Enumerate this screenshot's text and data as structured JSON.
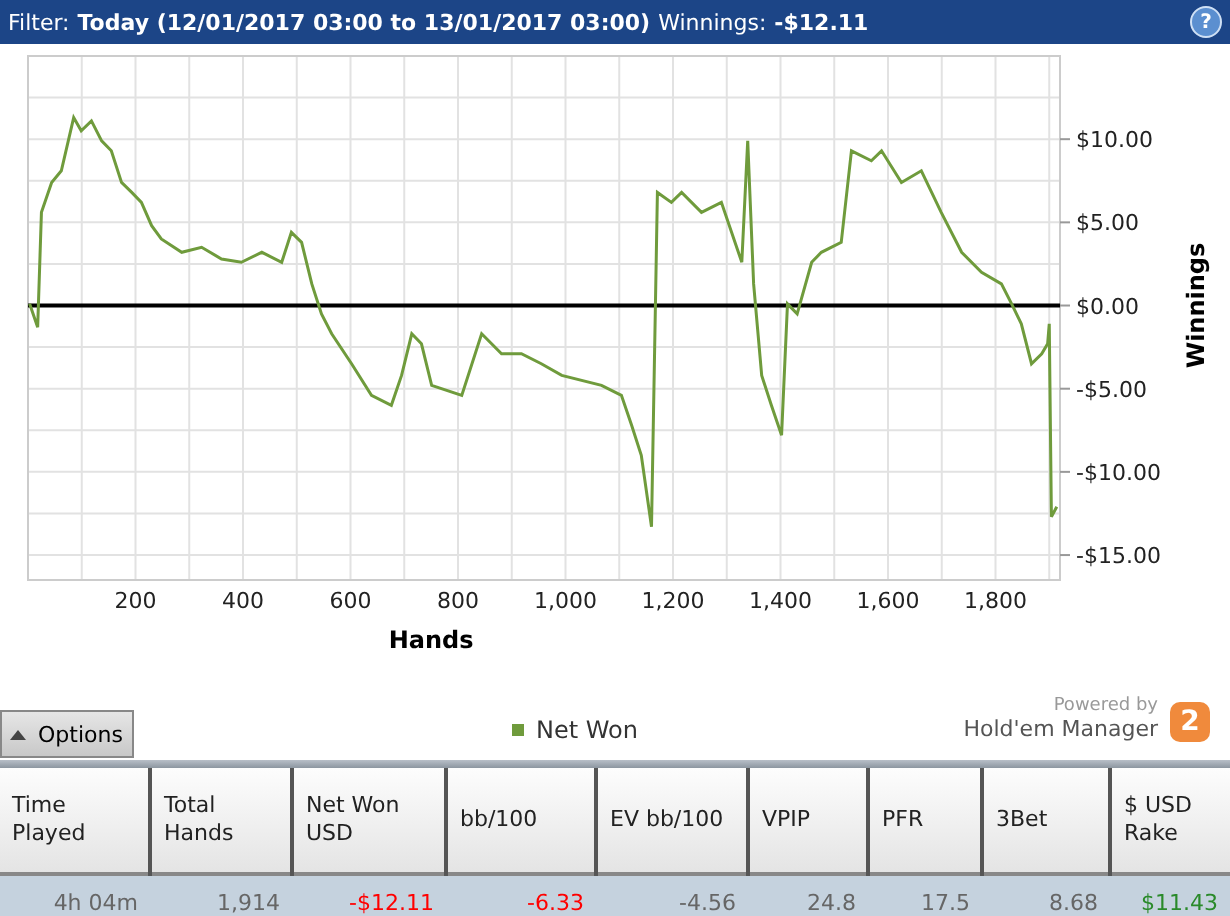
{
  "filter_bar": {
    "filter_label": "Filter:",
    "filter_value": "Today (12/01/2017 03:00 to 13/01/2017 03:00)",
    "winnings_label": "Winnings:",
    "winnings_value": "-$12.11",
    "help": "?"
  },
  "chart": {
    "chart_data": {
      "type": "line",
      "grid": true,
      "xlabel": "Hands",
      "ylabel": "Winnings",
      "xlim": [
        0,
        1920
      ],
      "ylim": [
        -16.5,
        15
      ],
      "xticks": [
        {
          "value": 200,
          "label": "200"
        },
        {
          "value": 400,
          "label": "400"
        },
        {
          "value": 600,
          "label": "600"
        },
        {
          "value": 800,
          "label": "800"
        },
        {
          "value": 1000,
          "label": "1,000"
        },
        {
          "value": 1200,
          "label": "1,200"
        },
        {
          "value": 1400,
          "label": "1,400"
        },
        {
          "value": 1600,
          "label": "1,600"
        },
        {
          "value": 1800,
          "label": "1,800"
        }
      ],
      "yticks": [
        {
          "value": 10,
          "label": "$10.00"
        },
        {
          "value": 5,
          "label": "$5.00"
        },
        {
          "value": 0,
          "label": "$0.00"
        },
        {
          "value": -5,
          "label": "-$5.00"
        },
        {
          "value": -10,
          "label": "-$10.00"
        },
        {
          "value": -15,
          "label": "-$15.00"
        }
      ],
      "x": [
        3,
        18,
        25,
        44,
        62,
        85,
        99,
        118,
        137,
        155,
        174,
        193,
        211,
        230,
        248,
        286,
        323,
        360,
        397,
        435,
        472,
        490,
        509,
        528,
        546,
        565,
        602,
        639,
        676,
        695,
        714,
        732,
        751,
        807,
        844,
        881,
        918,
        955,
        993,
        1067,
        1104,
        1123,
        1141,
        1160,
        1171,
        1197,
        1216,
        1253,
        1290,
        1328,
        1339,
        1350,
        1365,
        1383,
        1402,
        1413,
        1431,
        1458,
        1476,
        1513,
        1532,
        1569,
        1588,
        1625,
        1662,
        1699,
        1737,
        1774,
        1811,
        1830,
        1848,
        1867,
        1886,
        1897,
        1900,
        1904,
        1914
      ],
      "series": [
        {
          "name": "Net Won",
          "color": "#6f9b3c",
          "values": [
            0.1,
            -1.3,
            5.6,
            7.4,
            8.1,
            11.3,
            10.5,
            11.1,
            9.9,
            9.3,
            7.4,
            6.8,
            6.2,
            4.8,
            4.0,
            3.2,
            3.5,
            2.8,
            2.6,
            3.2,
            2.6,
            4.4,
            3.8,
            1.3,
            -0.5,
            -1.7,
            -3.5,
            -5.4,
            -6.0,
            -4.2,
            -1.7,
            -2.3,
            -4.8,
            -5.4,
            -1.7,
            -2.9,
            -2.9,
            -3.5,
            -4.2,
            -4.8,
            -5.4,
            -7.2,
            -9.0,
            -13.3,
            6.8,
            6.2,
            6.8,
            5.6,
            6.2,
            2.6,
            9.9,
            1.3,
            -4.2,
            -6.0,
            -7.8,
            0.1,
            -0.5,
            2.6,
            3.2,
            3.8,
            9.3,
            8.7,
            9.3,
            7.4,
            8.1,
            5.6,
            3.2,
            2.0,
            1.3,
            0.1,
            -1.1,
            -3.5,
            -2.9,
            -2.3,
            -1.1,
            -12.7,
            -12.1
          ]
        }
      ]
    }
  },
  "options_button": {
    "label": "Options"
  },
  "branding": {
    "powered_by": "Powered by",
    "product": "Hold'em Manager",
    "badge": "2"
  },
  "table": {
    "columns": [
      {
        "label": "Time Played"
      },
      {
        "label": "Total Hands"
      },
      {
        "label": "Net Won USD"
      },
      {
        "label": "bb/100"
      },
      {
        "label": "EV bb/100"
      },
      {
        "label": "VPIP"
      },
      {
        "label": "PFR"
      },
      {
        "label": "3Bet"
      },
      {
        "label": "$ USD Rake"
      }
    ],
    "rows": [
      [
        {
          "text": "4h 04m",
          "color": "#666666"
        },
        {
          "text": "1,914",
          "color": "#666666"
        },
        {
          "text": "-$12.11",
          "color": "#ff0000"
        },
        {
          "text": "-6.33",
          "color": "#ff0000"
        },
        {
          "text": "-4.56",
          "color": "#666666"
        },
        {
          "text": "24.8",
          "color": "#666666"
        },
        {
          "text": "17.5",
          "color": "#666666"
        },
        {
          "text": "8.68",
          "color": "#666666"
        },
        {
          "text": "$11.43",
          "color": "#2a8a2a"
        }
      ]
    ]
  }
}
